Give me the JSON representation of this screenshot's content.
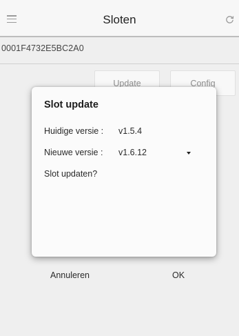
{
  "appbar": {
    "title": "Sloten",
    "menu_icon": "hamburger-menu-icon",
    "refresh_icon": "refresh-icon"
  },
  "device": {
    "id": "0001F4732E5BC2A0"
  },
  "actions": {
    "update_label": "Update",
    "config_label": "Config"
  },
  "dialog": {
    "title": "Slot update",
    "current_version_label": "Huidige versie :",
    "current_version_value": "v1.5.4",
    "new_version_label": "Nieuwe versie :",
    "new_version_value": "v1.6.12",
    "question": "Slot updaten?",
    "cancel_label": "Annuleren",
    "ok_label": "OK"
  }
}
